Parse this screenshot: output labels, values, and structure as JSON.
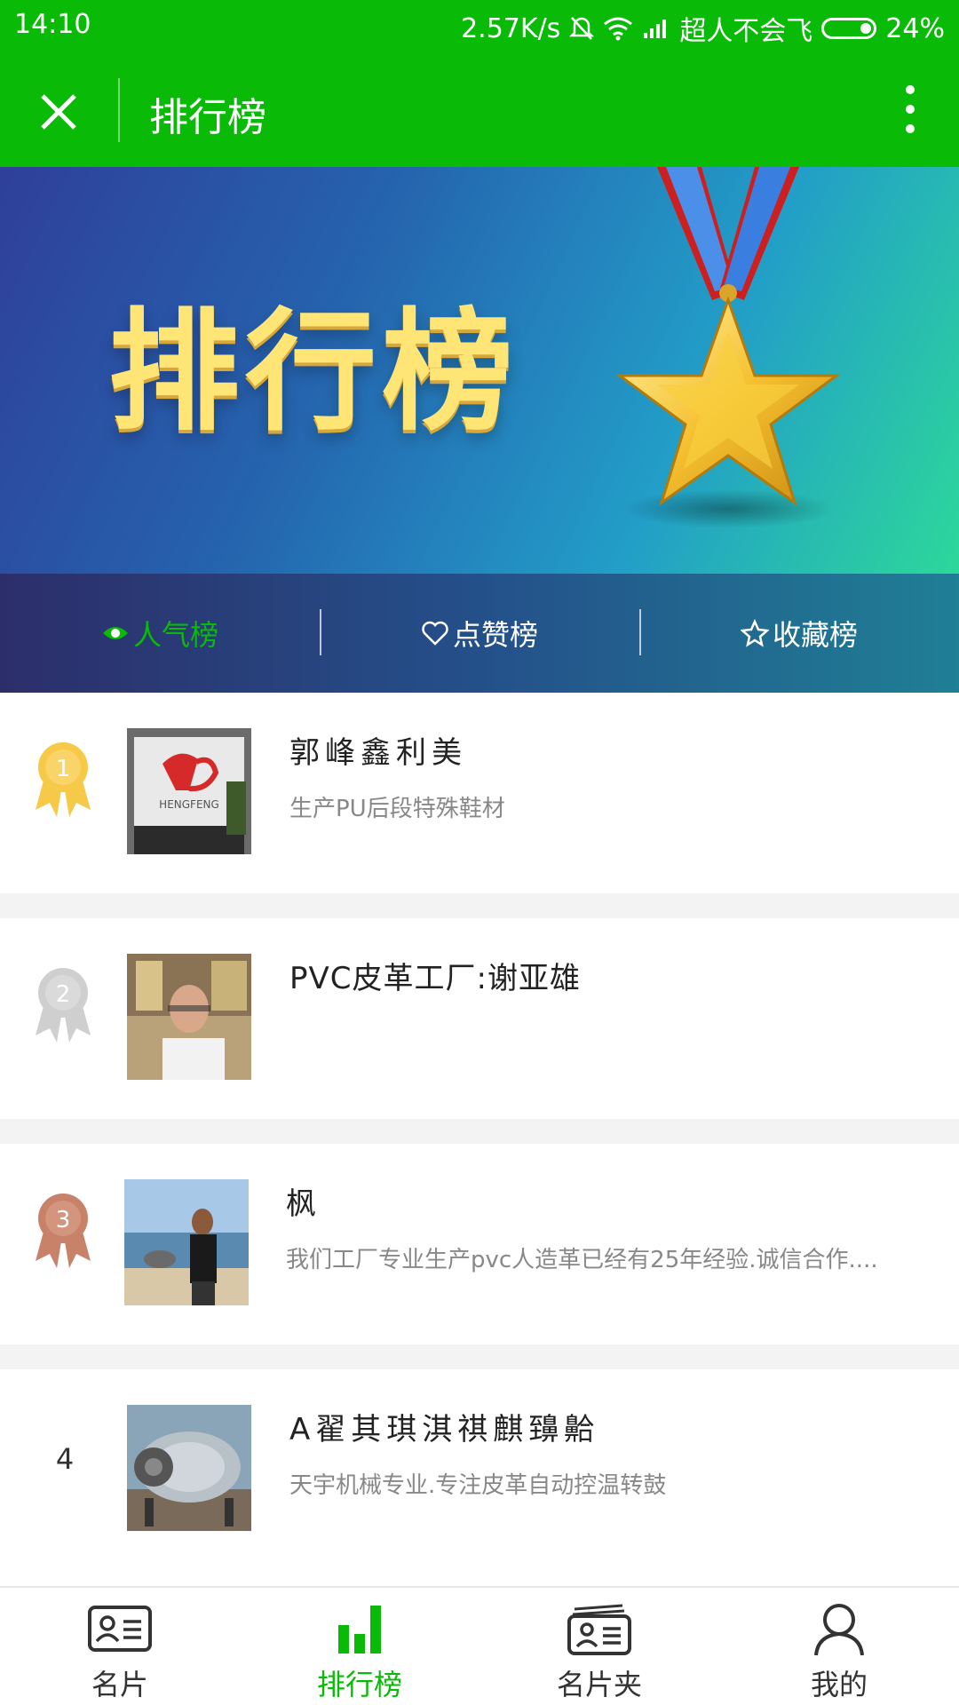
{
  "status_bar": {
    "time": "14:10",
    "speed": "2.57K/s",
    "carrier": "超人不会飞",
    "battery": "24%"
  },
  "header": {
    "title": "排行榜"
  },
  "banner": {
    "title": "排行榜"
  },
  "tabs": [
    {
      "label": "人气榜",
      "icon": "eye-icon",
      "active": true
    },
    {
      "label": "点赞榜",
      "icon": "heart-icon",
      "active": false
    },
    {
      "label": "收藏榜",
      "icon": "star-icon",
      "active": false
    }
  ],
  "list": [
    {
      "rank": "1",
      "name": "郭峰鑫利美",
      "desc": "生产PU后段特殊鞋材"
    },
    {
      "rank": "2",
      "name": "PVC皮革工厂:谢亚雄",
      "desc": ""
    },
    {
      "rank": "3",
      "name": "枫",
      "desc": "我们工厂专业生产pvc人造革已经有25年经验.诚信合作...."
    },
    {
      "rank": "4",
      "name": "A翟其琪淇祺麒䶍䶎",
      "desc": "天宇机械专业.专注皮革自动控温转鼓"
    }
  ],
  "avatar_text": {
    "logo": "HENGFENG"
  },
  "bottom_nav": [
    {
      "label": "名片",
      "icon": "card-icon",
      "active": false
    },
    {
      "label": "排行榜",
      "icon": "bar-chart-icon",
      "active": true
    },
    {
      "label": "名片夹",
      "icon": "card-holder-icon",
      "active": false
    },
    {
      "label": "我的",
      "icon": "user-icon",
      "active": false
    }
  ],
  "colors": {
    "brand_green": "#09bb07",
    "gold": "#f7c948",
    "silver": "#cfcfcf",
    "bronze": "#c8826a"
  }
}
